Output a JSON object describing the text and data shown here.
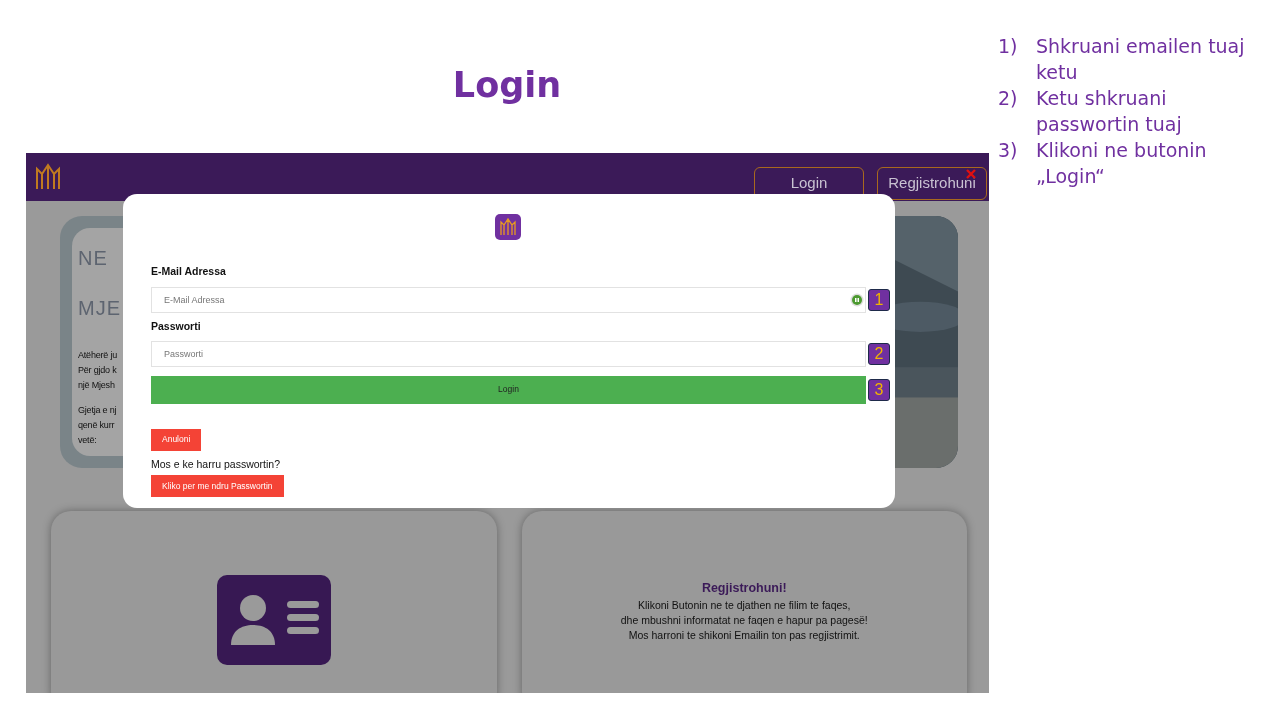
{
  "slide": {
    "title": "Login",
    "instructions": [
      {
        "number": "1)",
        "text": "Shkruani emailen tuaj ketu"
      },
      {
        "number": "2)",
        "text": "Ketu shkruani passwortin tuaj"
      },
      {
        "number": "3)",
        "text": "Klikoni ne butonin „Login“"
      }
    ]
  },
  "screenshot": {
    "navbar": {
      "buttons": [
        {
          "label": "Login",
          "kind": "login"
        },
        {
          "label": "Regjistrohuni",
          "kind": "register"
        }
      ]
    },
    "hero": {
      "heading_lines": [
        "NE",
        "MJE"
      ],
      "paragraphs": [
        [
          "Atëherë ju",
          "Për gjdo k",
          "një Mjesh"
        ],
        [
          "Gjetja e nj",
          "qenë kurr",
          "vetë:"
        ]
      ]
    },
    "modal": {
      "email_label": "E-Mail Adressa",
      "email_placeholder": "E-Mail Adressa",
      "password_label": "Passworti",
      "password_placeholder": "Passworti",
      "login_button": "Login",
      "cancel_button": "Anuloni",
      "forgot_text": "Mos e ke harru passwortin?",
      "reset_button": "Kliko per me ndru Passwortin",
      "callouts": [
        "1",
        "2",
        "3"
      ]
    },
    "register_card": {
      "title": "Regjistrohuni!",
      "lines": [
        "Klikoni Butonin ne te djathen ne filim te faqes,",
        "dhe mbushni informatat ne faqen e hapur pa pagesë!",
        "Mos harroni te shikoni Emailin ton pas regjistrimit."
      ]
    }
  }
}
